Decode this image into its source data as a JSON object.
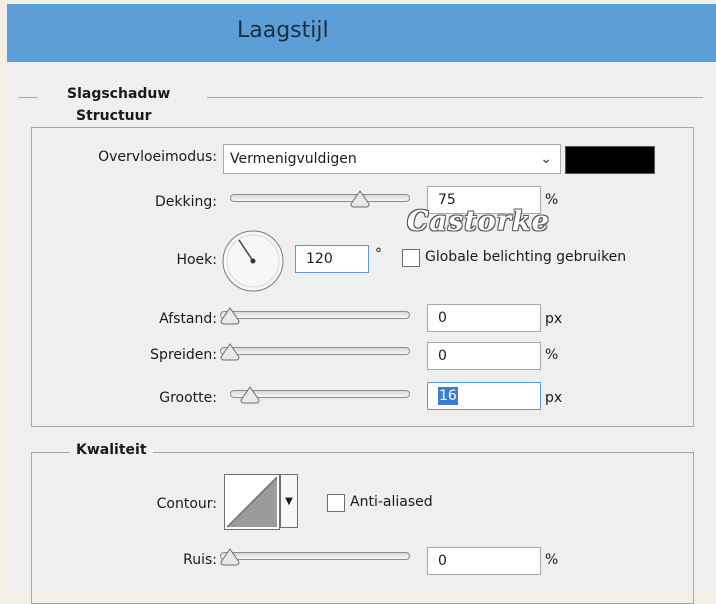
{
  "window": {
    "title": "Laagstijl"
  },
  "section": {
    "title": "Slagschaduw"
  },
  "structure": {
    "title": "Structuur",
    "blend_mode": {
      "label": "Overvloeimodus:",
      "value": "Vermenigvuldigen",
      "color": "#000000"
    },
    "opacity": {
      "label": "Dekking:",
      "value": "75",
      "unit": "%",
      "slider_fraction": 0.75
    },
    "angle": {
      "label": "Hoek:",
      "value": "120",
      "unit": "°",
      "global_light_label": "Globale belichting gebruiken",
      "global_light_checked": false
    },
    "distance": {
      "label": "Afstand:",
      "value": "0",
      "unit": "px",
      "slider_fraction": 0.0
    },
    "spread": {
      "label": "Spreiden:",
      "value": "0",
      "unit": "%",
      "slider_fraction": 0.0
    },
    "size": {
      "label": "Grootte:",
      "value": "16",
      "unit": "px",
      "slider_fraction": 0.06
    }
  },
  "quality": {
    "title": "Kwaliteit",
    "contour": {
      "label": "Contour:",
      "anti_aliased_label": "Anti-aliased",
      "anti_aliased_checked": false
    },
    "noise": {
      "label": "Ruis:",
      "value": "0",
      "unit": "%",
      "slider_fraction": 0.0
    }
  },
  "watermark": {
    "text": "Castorke"
  }
}
